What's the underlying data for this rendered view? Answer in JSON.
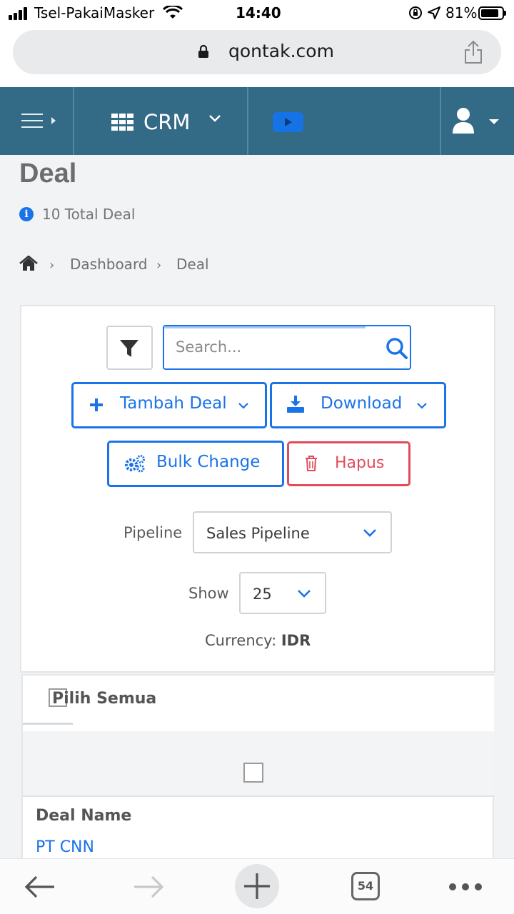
{
  "status_bar": {
    "carrier": "Tsel-PakaiMasker",
    "time": "14:40",
    "battery": "81%"
  },
  "browser": {
    "url": "qontak.com"
  },
  "app_header": {
    "module": "CRM"
  },
  "page": {
    "title": "Deal",
    "total": "10 Total Deal"
  },
  "breadcrumb": {
    "items": [
      "Dashboard",
      "Deal"
    ]
  },
  "toolbar": {
    "search_placeholder": "Search...",
    "add_label": "Tambah Deal",
    "download_label": "Download",
    "bulk_label": "Bulk Change",
    "delete_label": "Hapus"
  },
  "filters": {
    "pipeline_label": "Pipeline",
    "pipeline_value": "Sales Pipeline",
    "show_label": "Show",
    "show_value": "25",
    "currency_label": "Currency:",
    "currency_value": "IDR"
  },
  "table": {
    "select_all_label": "Pilih Semua",
    "column_label": "Deal Name",
    "rows": [
      "PT CNN"
    ]
  },
  "bottom_bar": {
    "tab_count": "54"
  },
  "colors": {
    "header_bg": "#336a86",
    "accent": "#1a73e8",
    "danger": "#e24b5b"
  }
}
